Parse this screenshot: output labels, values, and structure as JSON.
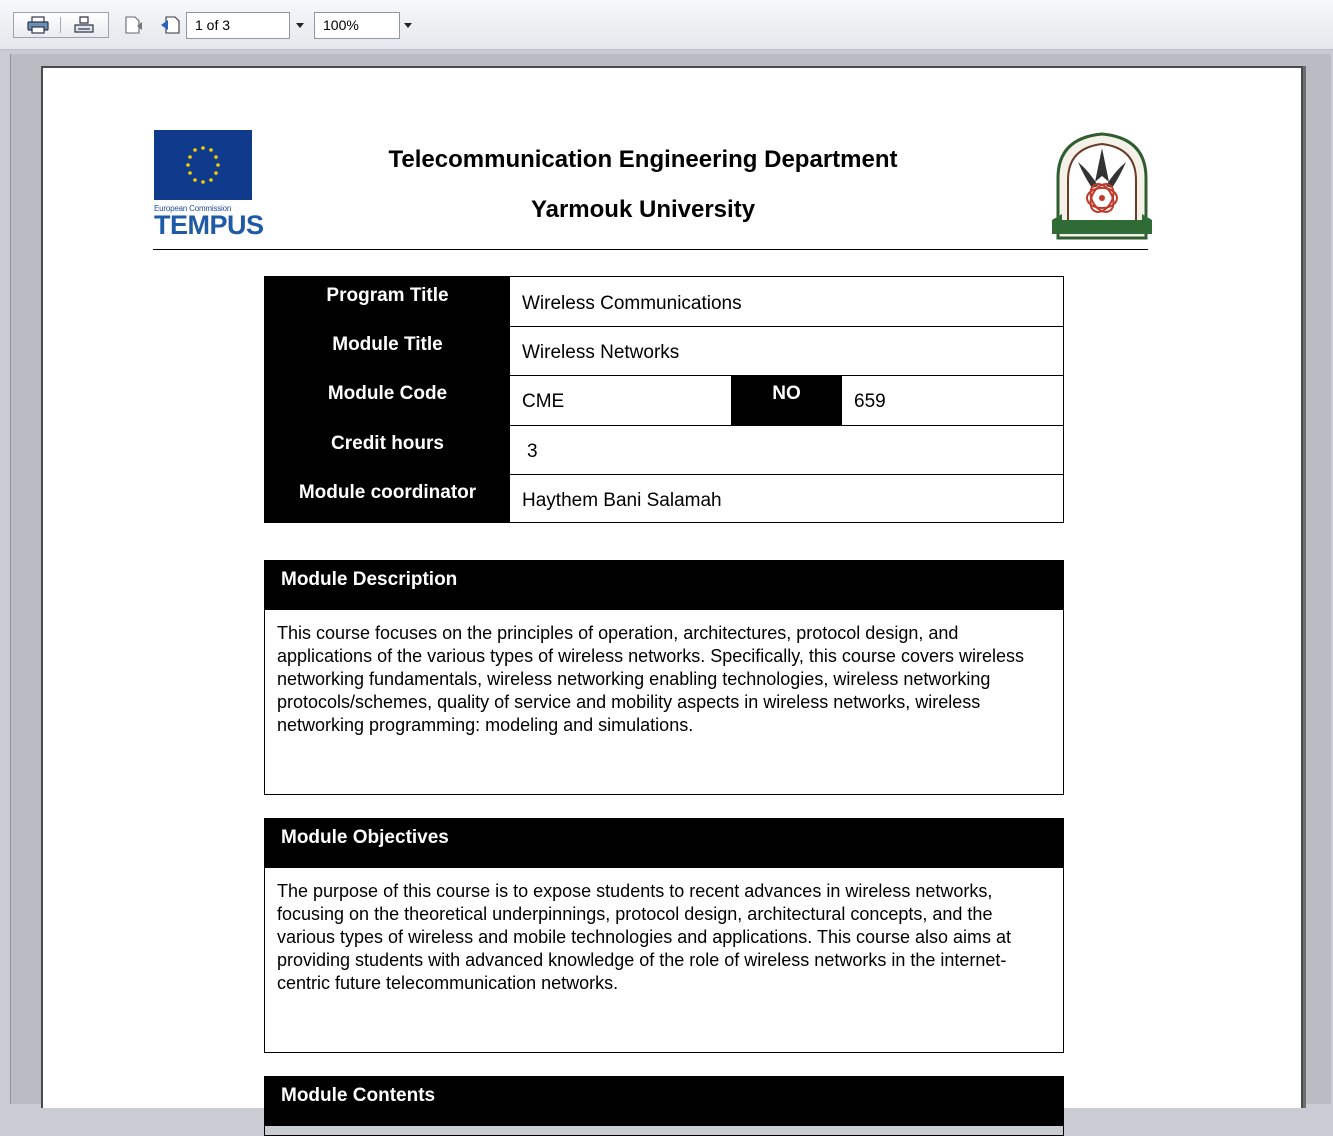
{
  "toolbar": {
    "page_indicator": "1 of 3",
    "zoom": "100%"
  },
  "header": {
    "logo_left_small": "European Commission",
    "logo_left_big": "TEMPUS",
    "title_line1": "Telecommunication Engineering Department",
    "title_line2": "Yarmouk University"
  },
  "info": {
    "program_title_label": "Program Title",
    "program_title_value": "Wireless Communications",
    "module_title_label": "Module Title",
    "module_title_value": "Wireless Networks",
    "module_code_label": "Module Code",
    "module_code_value": "CME",
    "no_label": "NO",
    "no_value": "659",
    "credit_hours_label": "Credit hours",
    "credit_hours_value": "3",
    "coordinator_label": "Module coordinator",
    "coordinator_value": "Haythem Bani Salamah"
  },
  "description": {
    "heading": "Module Description",
    "text": "This course focuses on the principles of operation, architectures, protocol design, and applications of the various types of wireless networks. Specifically, this course covers wireless networking fundamentals, wireless networking enabling technologies, wireless networking protocols/schemes, quality of service and mobility aspects in wireless networks, wireless networking programming: modeling and simulations."
  },
  "objectives": {
    "heading": "Module Objectives",
    "text": "The purpose of this course is to expose students to recent advances in wireless networks, focusing on the theoretical underpinnings, protocol design, architectural concepts, and the various types of wireless and mobile technologies and applications. This course also aims at providing students with advanced knowledge of the role of wireless networks in the internet-centric future telecommunication networks."
  },
  "contents": {
    "heading": "Module Contents"
  }
}
